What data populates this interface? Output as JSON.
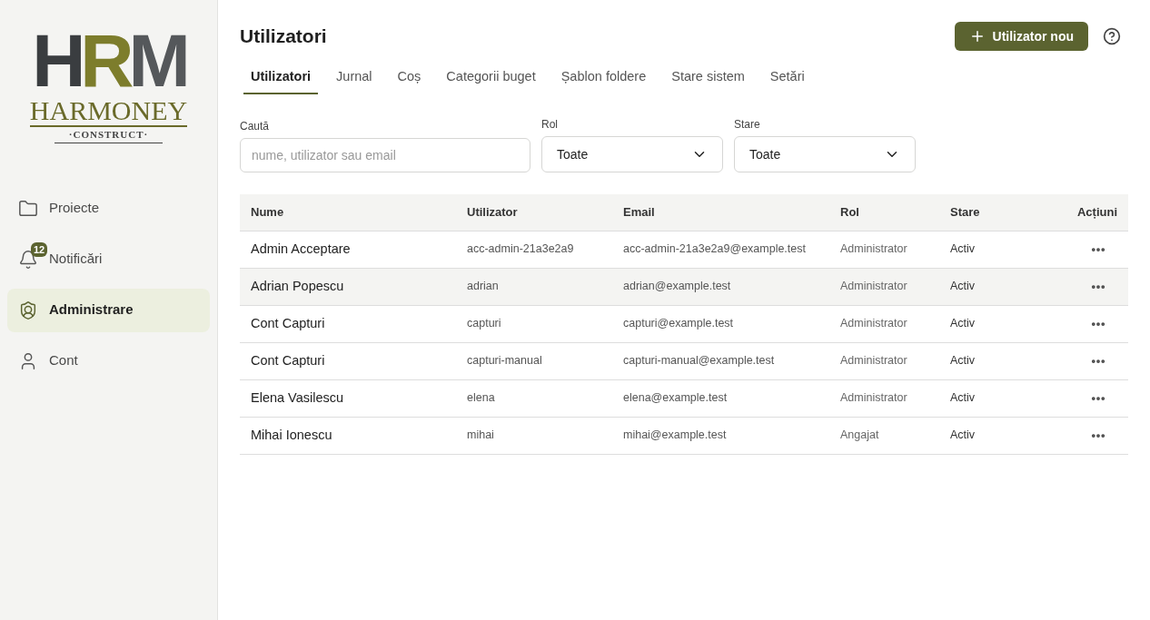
{
  "logo": {
    "mark_left": "H",
    "mark_middle": "R",
    "mark_right": "M",
    "name": "HARMONEY",
    "tagline": "·CONSTRUCT·"
  },
  "sidebar": {
    "items": [
      {
        "label": "Proiecte",
        "selected": false
      },
      {
        "label": "Notificări",
        "badge": "12",
        "selected": false
      },
      {
        "label": "Administrare",
        "selected": true
      },
      {
        "label": "Cont",
        "selected": false
      }
    ]
  },
  "page": {
    "title": "Utilizatori",
    "new_button": "Utilizator nou"
  },
  "tabs": [
    {
      "label": "Utilizatori",
      "selected": true
    },
    {
      "label": "Jurnal",
      "selected": false
    },
    {
      "label": "Coș",
      "selected": false
    },
    {
      "label": "Categorii buget",
      "selected": false
    },
    {
      "label": "Șablon foldere",
      "selected": false
    },
    {
      "label": "Stare sistem",
      "selected": false
    },
    {
      "label": "Setări",
      "selected": false
    }
  ],
  "filters": {
    "search": {
      "label": "Caută",
      "placeholder": "nume, utilizator sau email"
    },
    "role": {
      "label": "Rol",
      "value": "Toate"
    },
    "status": {
      "label": "Stare",
      "value": "Toate"
    }
  },
  "table": {
    "columns": [
      "Nume",
      "Utilizator",
      "Email",
      "Rol",
      "Stare",
      "Acțiuni"
    ],
    "rows": [
      {
        "name": "Admin Acceptare",
        "username": "acc-admin-21a3e2a9",
        "email": "acc-admin-21a3e2a9@example.test",
        "role": "Administrator",
        "status": "Activ",
        "selected": false
      },
      {
        "name": "Adrian Popescu",
        "username": "adrian",
        "email": "adrian@example.test",
        "role": "Administrator",
        "status": "Activ",
        "selected": true
      },
      {
        "name": "Cont Capturi",
        "username": "capturi",
        "email": "capturi@example.test",
        "role": "Administrator",
        "status": "Activ",
        "selected": false
      },
      {
        "name": "Cont Capturi",
        "username": "capturi-manual",
        "email": "capturi-manual@example.test",
        "role": "Administrator",
        "status": "Activ",
        "selected": false
      },
      {
        "name": "Elena Vasilescu",
        "username": "elena",
        "email": "elena@example.test",
        "role": "Administrator",
        "status": "Activ",
        "selected": false
      },
      {
        "name": "Mihai Ionescu",
        "username": "mihai",
        "email": "mihai@example.test",
        "role": "Angajat",
        "status": "Activ",
        "selected": false
      }
    ]
  }
}
